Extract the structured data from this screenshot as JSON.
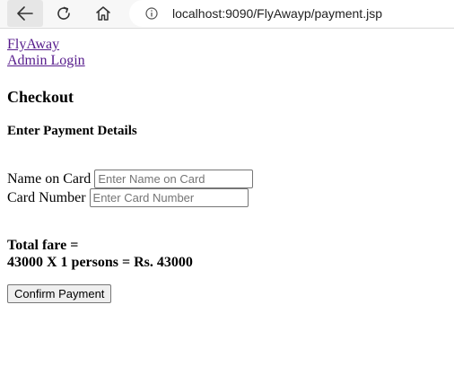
{
  "browser": {
    "url": "localhost:9090/FlyAwayp/payment.jsp",
    "icons": [
      "back-arrow-icon",
      "refresh-icon",
      "home-icon",
      "info-icon"
    ]
  },
  "nav": {
    "home_link": "FlyAway",
    "admin_link": "Admin Login"
  },
  "page": {
    "title": "Checkout",
    "subtitle": "Enter Payment Details"
  },
  "form": {
    "name_label": "Name on Card",
    "name_placeholder": "Enter Name on Card",
    "name_value": "",
    "card_label": "Card Number",
    "card_placeholder": "Enter Card Number",
    "card_value": ""
  },
  "summary": {
    "total_label": "Total fare =",
    "total_calc": "43000 X 1 persons = Rs. 43000"
  },
  "actions": {
    "confirm_label": "Confirm Payment"
  },
  "colors": {
    "link_visited": "#551a8b",
    "toolbar_bg": "#f7f7f7"
  }
}
